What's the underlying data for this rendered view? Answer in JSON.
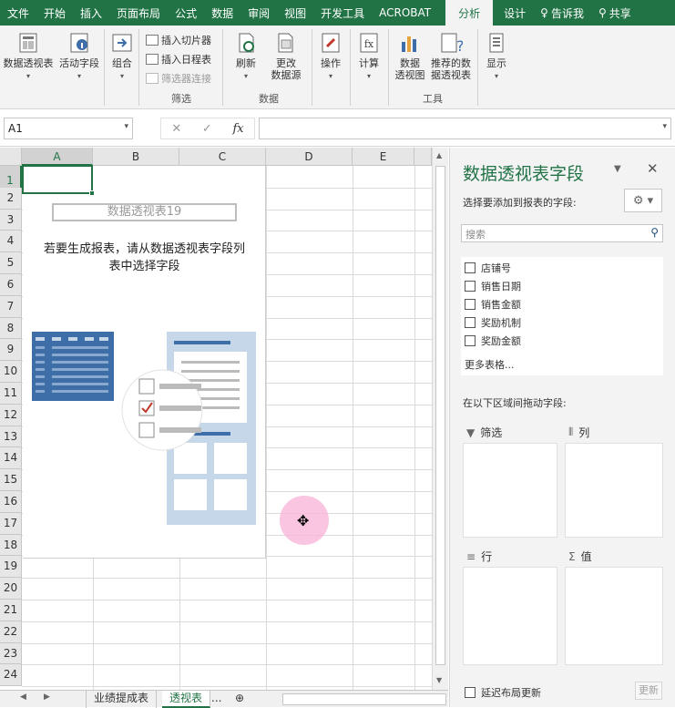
{
  "tabs": [
    {
      "label": "文件"
    },
    {
      "label": "开始"
    },
    {
      "label": "插入"
    },
    {
      "label": "页面布局"
    },
    {
      "label": "公式"
    },
    {
      "label": "数据"
    },
    {
      "label": "审阅"
    },
    {
      "label": "视图"
    },
    {
      "label": "开发工具"
    },
    {
      "label": "ACROBAT"
    },
    {
      "label": "分析"
    },
    {
      "label": "设计"
    }
  ],
  "tell_me": "告诉我",
  "share": "共享",
  "ribbon": {
    "pivot_table": "数据透视表",
    "active_field": "活动字段",
    "group": "组合",
    "insert_slicer": "插入切片器",
    "insert_timeline": "插入日程表",
    "filter_connections": "筛选器连接",
    "filter_group": "筛选",
    "refresh": "刷新",
    "change_source_1": "更改",
    "change_source_2": "数据源",
    "data_group": "数据",
    "actions": "操作",
    "calculations": "计算",
    "pivot_chart_1": "数据",
    "pivot_chart_2": "透视图",
    "recommended_1": "推荐的数",
    "recommended_2": "据透视表",
    "tools_group": "工具",
    "show": "显示"
  },
  "formula": {
    "name_box": "A1",
    "fx": "fx"
  },
  "columns": [
    "A",
    "B",
    "C",
    "D",
    "E"
  ],
  "rows": [
    "1",
    "2",
    "3",
    "4",
    "5",
    "6",
    "7",
    "8",
    "9",
    "10",
    "11",
    "12",
    "13",
    "14",
    "15",
    "16",
    "17",
    "18",
    "19",
    "20",
    "21",
    "22",
    "23",
    "24"
  ],
  "pivot": {
    "title": "数据透视表19",
    "message_1": "若要生成报表，请从数据透视表字段列",
    "message_2": "表中选择字段"
  },
  "sheets": {
    "tab1": "业绩提成表",
    "tab2": "透视表",
    "more": "...",
    "add": "⊕"
  },
  "pane": {
    "title": "数据透视表字段",
    "subtitle": "选择要添加到报表的字段:",
    "search_placeholder": "搜索",
    "fields": [
      "店铺号",
      "销售日期",
      "销售金额",
      "奖励机制",
      "奖励金额"
    ],
    "more_tables": "更多表格...",
    "drag_label": "在以下区域间拖动字段:",
    "areas": {
      "filter": "筛选",
      "columns": "列",
      "rows": "行",
      "values": "值"
    },
    "defer": "延迟布局更新",
    "update": "更新"
  },
  "colors": {
    "accent": "#217346",
    "pivot_icon": "#3d6ea8",
    "pivot_icon_light": "#c6d7ea"
  }
}
